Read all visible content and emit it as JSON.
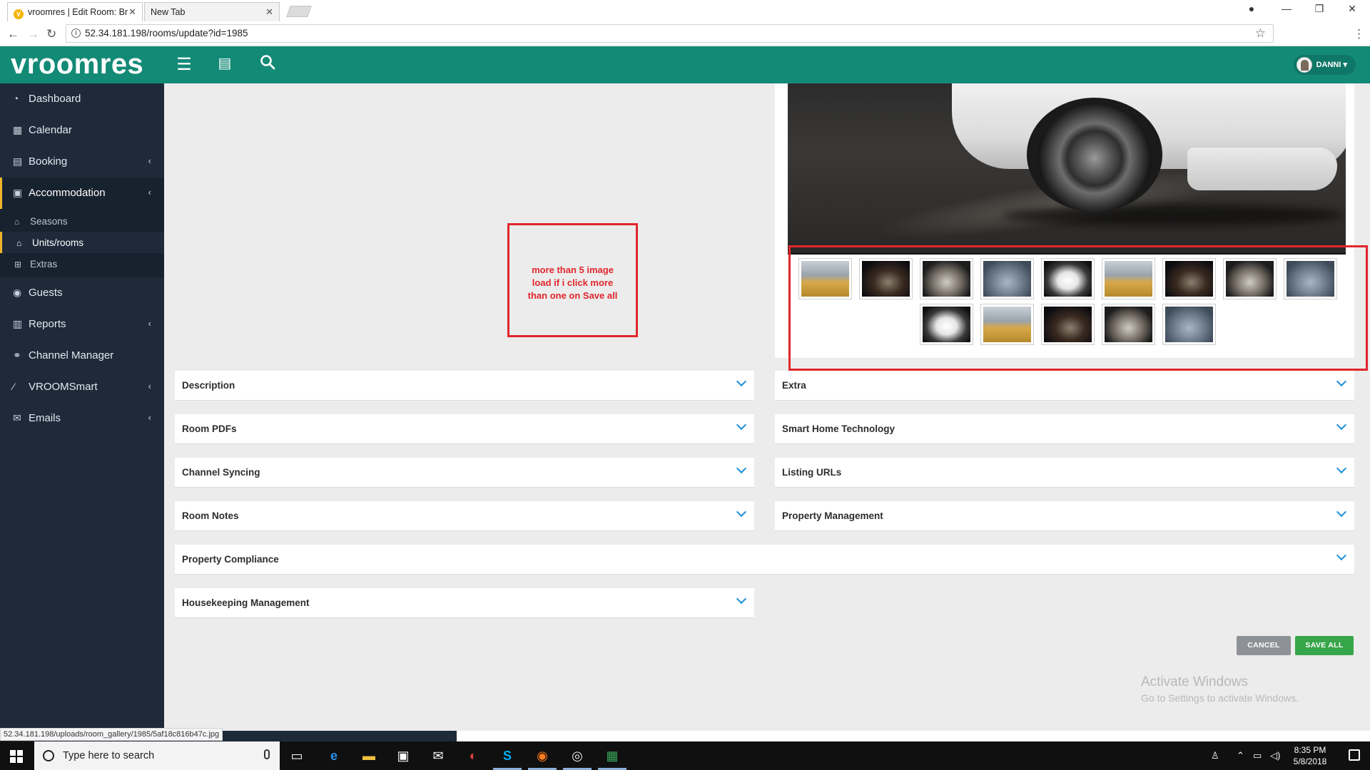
{
  "browser": {
    "tabs": [
      {
        "title": "vroomres | Edit Room: Br"
      },
      {
        "title": "New Tab"
      }
    ],
    "url": "52.34.181.198/rooms/update?id=1985",
    "status_url": "52.34.181.198/uploads/room_gallery/1985/5af18c816b47c.jpg"
  },
  "header": {
    "logo": "vroomres",
    "user_name": "DANNI"
  },
  "sidebar": {
    "items": [
      {
        "label": "Dashboard",
        "icon": "dashboard-icon"
      },
      {
        "label": "Calendar",
        "icon": "calendar-icon"
      },
      {
        "label": "Booking",
        "icon": "booking-icon"
      },
      {
        "label": "Accommodation",
        "icon": "accommodation-icon"
      },
      {
        "label": "Guests",
        "icon": "guests-icon"
      },
      {
        "label": "Reports",
        "icon": "reports-icon"
      },
      {
        "label": "Channel Manager",
        "icon": "channel-icon"
      },
      {
        "label": "VROOMSmart",
        "icon": "wand-icon"
      },
      {
        "label": "Emails",
        "icon": "email-icon"
      }
    ],
    "sub_items": [
      {
        "label": "Seasons"
      },
      {
        "label": "Units/rooms"
      },
      {
        "label": "Extras"
      }
    ]
  },
  "annotation": {
    "line1": "more than 5 image",
    "line2": "load if i click more",
    "line3": "than one on Save all",
    "color": "#e0262c"
  },
  "panels": {
    "description": "Description",
    "room_pdfs": "Room PDFs",
    "channel_syncing": "Channel Syncing",
    "room_notes": "Room Notes",
    "property_compliance": "Property Compliance",
    "housekeeping": "Housekeeping Management",
    "extra": "Extra",
    "smart_home": "Smart Home Technology",
    "listing_urls": "Listing URLs",
    "property_management": "Property Management"
  },
  "buttons": {
    "cancel": "CANCEL",
    "save_all": "SAVE ALL"
  },
  "watermark": {
    "title": "Activate Windows",
    "subtitle": "Go to Settings to activate Windows."
  },
  "taskbar": {
    "search_placeholder": "Type here to search",
    "time": "8:35 PM",
    "date": "5/8/2018"
  },
  "colors": {
    "brand": "#138a76",
    "sidebar": "#1e2a3a",
    "save": "#37a64a",
    "cancel": "#8e9296",
    "chevron": "#1e8fd6"
  }
}
